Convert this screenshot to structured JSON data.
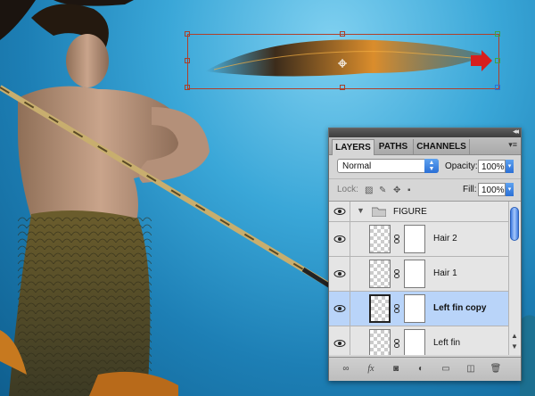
{
  "panel": {
    "tabs": [
      {
        "label": "LAYERS"
      },
      {
        "label": "PATHS"
      },
      {
        "label": "CHANNELS"
      }
    ],
    "blend_mode": "Normal",
    "opacity_label": "Opacity:",
    "opacity_value": "100%",
    "lock_label": "Lock:",
    "fill_label": "Fill:",
    "fill_value": "100%",
    "layers": [
      {
        "name": "FIGURE",
        "type": "group"
      },
      {
        "name": "Hair 2",
        "type": "layer"
      },
      {
        "name": "Hair 1",
        "type": "layer"
      },
      {
        "name": "Left fin copy",
        "type": "layer",
        "selected": true
      },
      {
        "name": "Left fin",
        "type": "layer"
      }
    ],
    "bottom_icons": [
      "link-layers-icon",
      "fx-icon",
      "add-mask-icon",
      "adjustment-layer-icon",
      "new-group-icon",
      "new-layer-icon",
      "trash-icon"
    ]
  },
  "colors": {
    "selection_highlight": "#b9d4f9",
    "transform_box": "#b0402a",
    "arrow_red": "#d81e1e"
  }
}
